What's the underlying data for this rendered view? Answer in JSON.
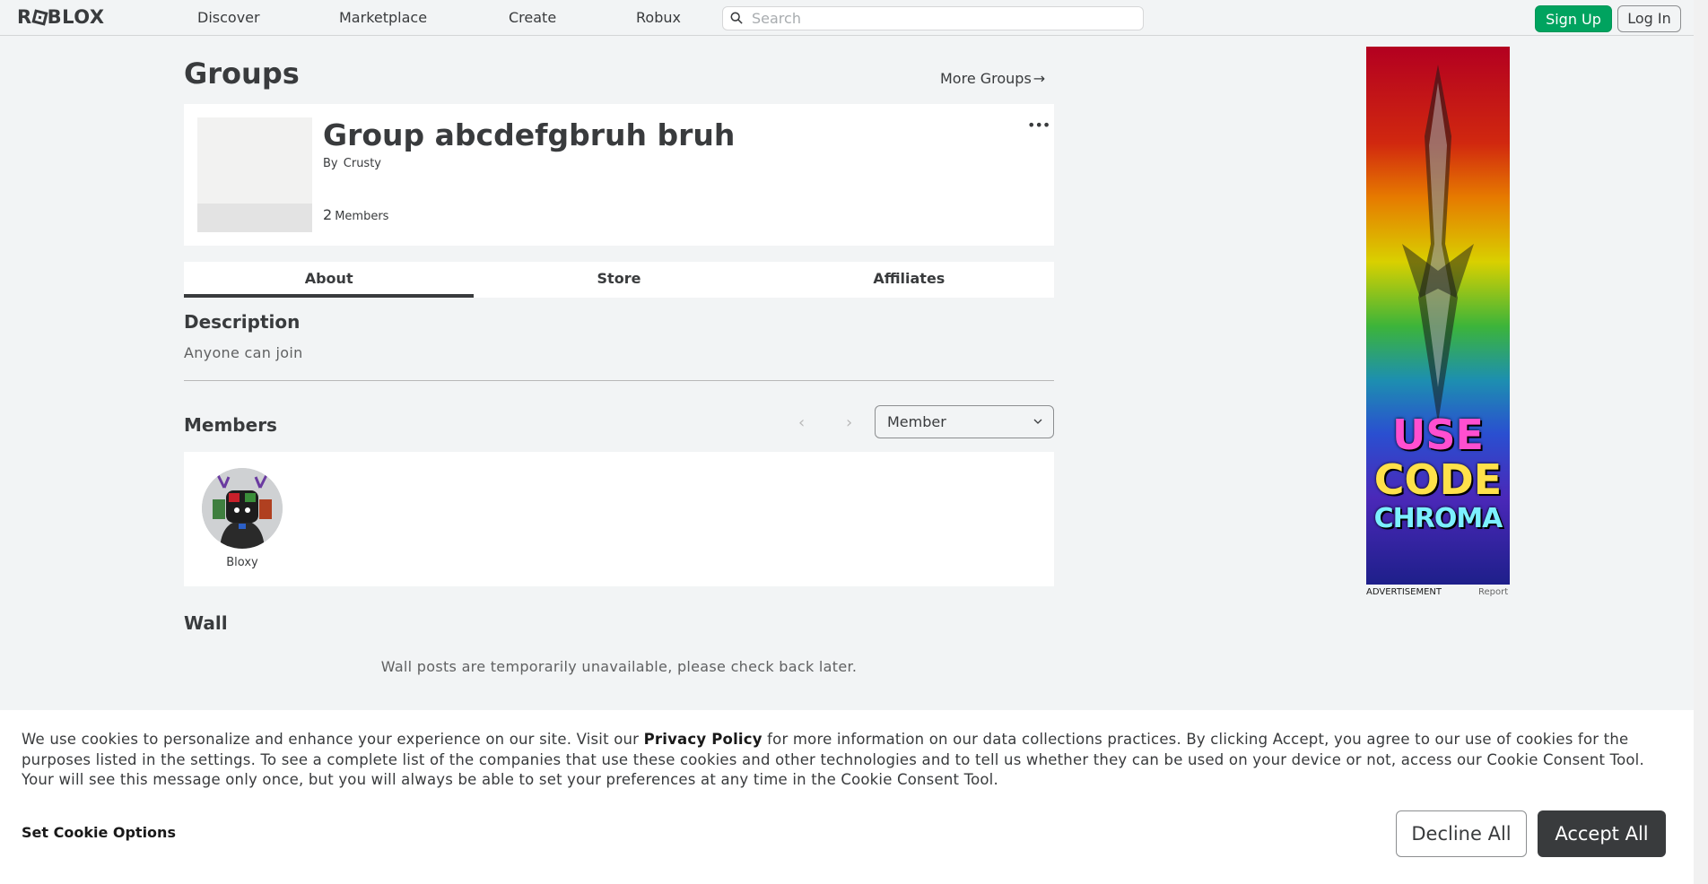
{
  "nav": {
    "logo": "ROBLOX",
    "links": [
      "Discover",
      "Marketplace",
      "Create",
      "Robux"
    ],
    "search_placeholder": "Search",
    "signup_label": "Sign Up",
    "login_label": "Log In"
  },
  "page": {
    "title": "Groups",
    "more_groups_label": "More Groups",
    "more_groups_arrow": "→"
  },
  "group": {
    "name": "Group abcdefgbruh bruh",
    "by_label": "By",
    "owner": "Crusty",
    "member_count": "2",
    "members_label": "Members",
    "menu_glyph": "•••"
  },
  "tabs": [
    {
      "label": "About",
      "active": true
    },
    {
      "label": "Store",
      "active": false
    },
    {
      "label": "Affiliates",
      "active": false
    }
  ],
  "about": {
    "description_heading": "Description",
    "description_text": "Anyone can join",
    "members_heading": "Members",
    "role_selected": "Member",
    "members": [
      {
        "name": "Bloxy",
        "icon": "avatar-headshot"
      }
    ],
    "wall_heading": "Wall",
    "wall_message": "Wall posts are temporarily unavailable, please check back later."
  },
  "ad": {
    "art_text_line1": "USE",
    "art_text_line2": "CODE",
    "art_text_line3": "CHROMA",
    "label": "ADVERTISEMENT",
    "report_label": "Report"
  },
  "cookie": {
    "text_part1": "We use cookies to personalize and enhance your experience on our site. Visit our ",
    "privacy_link": "Privacy Policy",
    "text_part2": " for more information on our data collections practices. By clicking Accept, you agree to our use of cookies for the purposes listed in the settings. To see a complete list of the companies that use these cookies and other technologies and to tell us whether they can be used on your device or not, access our Cookie Consent Tool. Your will see this message only once, but you will always be able to set your preferences at any time in the Cookie Consent Tool.",
    "options_label": "Set Cookie Options",
    "decline_label": "Decline All",
    "accept_label": "Accept All"
  },
  "colors": {
    "accent_green": "#00a35f",
    "text_primary": "#393b3d",
    "background": "#f2f4f5"
  }
}
